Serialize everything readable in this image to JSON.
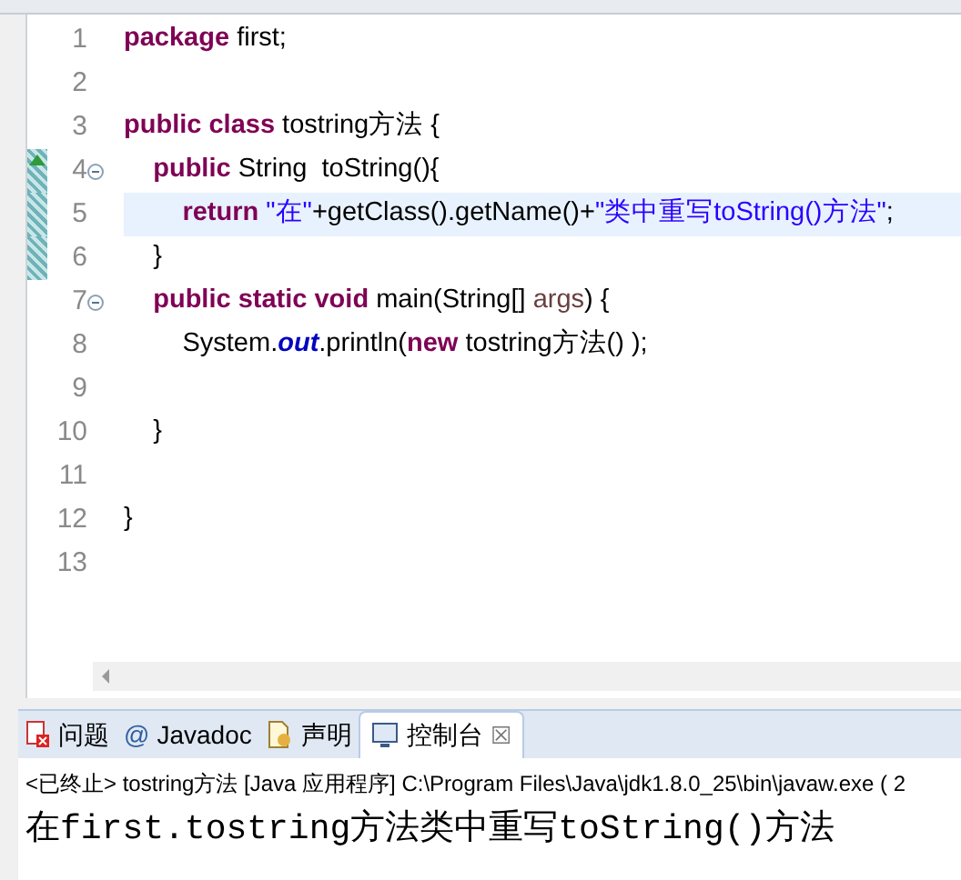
{
  "editor": {
    "lines": [
      {
        "number": "1",
        "current": false,
        "changed": false,
        "fold": false,
        "override": false,
        "tokens": [
          {
            "kind": "keyword",
            "text": "package"
          },
          {
            "kind": "plain",
            "text": " first;"
          }
        ]
      },
      {
        "number": "2",
        "current": false,
        "changed": false,
        "fold": false,
        "override": false
      },
      {
        "number": "3",
        "current": false,
        "changed": false,
        "fold": false,
        "override": false,
        "tokens": [
          {
            "kind": "keyword",
            "text": "public class"
          },
          {
            "kind": "plain",
            "text": " tostring方法 {"
          }
        ]
      },
      {
        "number": "4",
        "current": false,
        "changed": true,
        "fold": true,
        "override": true,
        "tokens": [
          {
            "kind": "keyword",
            "text": "    public"
          },
          {
            "kind": "plain",
            "text": " String  toString(){"
          }
        ]
      },
      {
        "number": "5",
        "current": true,
        "changed": true,
        "fold": false,
        "override": false,
        "tokens": [
          {
            "kind": "keyword",
            "text": "        return"
          },
          {
            "kind": "string",
            "text": " \"在\""
          },
          {
            "kind": "plain",
            "text": "+getClass().getName()+"
          },
          {
            "kind": "string",
            "text": "\"类中重写toString()方法\""
          },
          {
            "kind": "plain",
            "text": ";"
          }
        ]
      },
      {
        "number": "6",
        "current": false,
        "changed": true,
        "fold": false,
        "override": false,
        "tokens": [
          {
            "kind": "plain",
            "text": "    }"
          }
        ]
      },
      {
        "number": "7",
        "current": false,
        "changed": false,
        "fold": true,
        "override": false,
        "tokens": [
          {
            "kind": "keyword",
            "text": "    public static void"
          },
          {
            "kind": "plain",
            "text": " main(String[] "
          },
          {
            "kind": "param",
            "text": "args"
          },
          {
            "kind": "plain",
            "text": ") {"
          }
        ]
      },
      {
        "number": "8",
        "current": false,
        "changed": false,
        "fold": false,
        "override": false,
        "tokens": [
          {
            "kind": "plain",
            "text": "        System."
          },
          {
            "kind": "field",
            "text": "out"
          },
          {
            "kind": "plain",
            "text": ".println("
          },
          {
            "kind": "keyword",
            "text": "new"
          },
          {
            "kind": "plain",
            "text": " tostring方法() );"
          }
        ]
      },
      {
        "number": "9",
        "current": false,
        "changed": false,
        "fold": false,
        "override": false
      },
      {
        "number": "10",
        "current": false,
        "changed": false,
        "fold": false,
        "override": false,
        "tokens": [
          {
            "kind": "plain",
            "text": "    }"
          }
        ]
      },
      {
        "number": "11",
        "current": false,
        "changed": false,
        "fold": false,
        "override": false
      },
      {
        "number": "12",
        "current": false,
        "changed": false,
        "fold": false,
        "override": false,
        "tokens": [
          {
            "kind": "plain",
            "text": "}"
          }
        ]
      },
      {
        "number": "13",
        "current": false,
        "changed": false,
        "fold": false,
        "override": false
      }
    ]
  },
  "console": {
    "tabs": [
      {
        "kind": "problems",
        "label": "问题",
        "selected": false
      },
      {
        "kind": "javadoc",
        "icon_text": "@",
        "label": "Javadoc",
        "selected": false
      },
      {
        "kind": "declaration",
        "label": "声明",
        "selected": false
      },
      {
        "kind": "console",
        "label": "控制台",
        "selected": true,
        "close": "☒"
      }
    ],
    "header": "<已终止> tostring方法 [Java 应用程序] C:\\Program Files\\Java\\jdk1.8.0_25\\bin\\javaw.exe ( 2",
    "output": "在first.tostring方法类中重写toString()方法"
  }
}
